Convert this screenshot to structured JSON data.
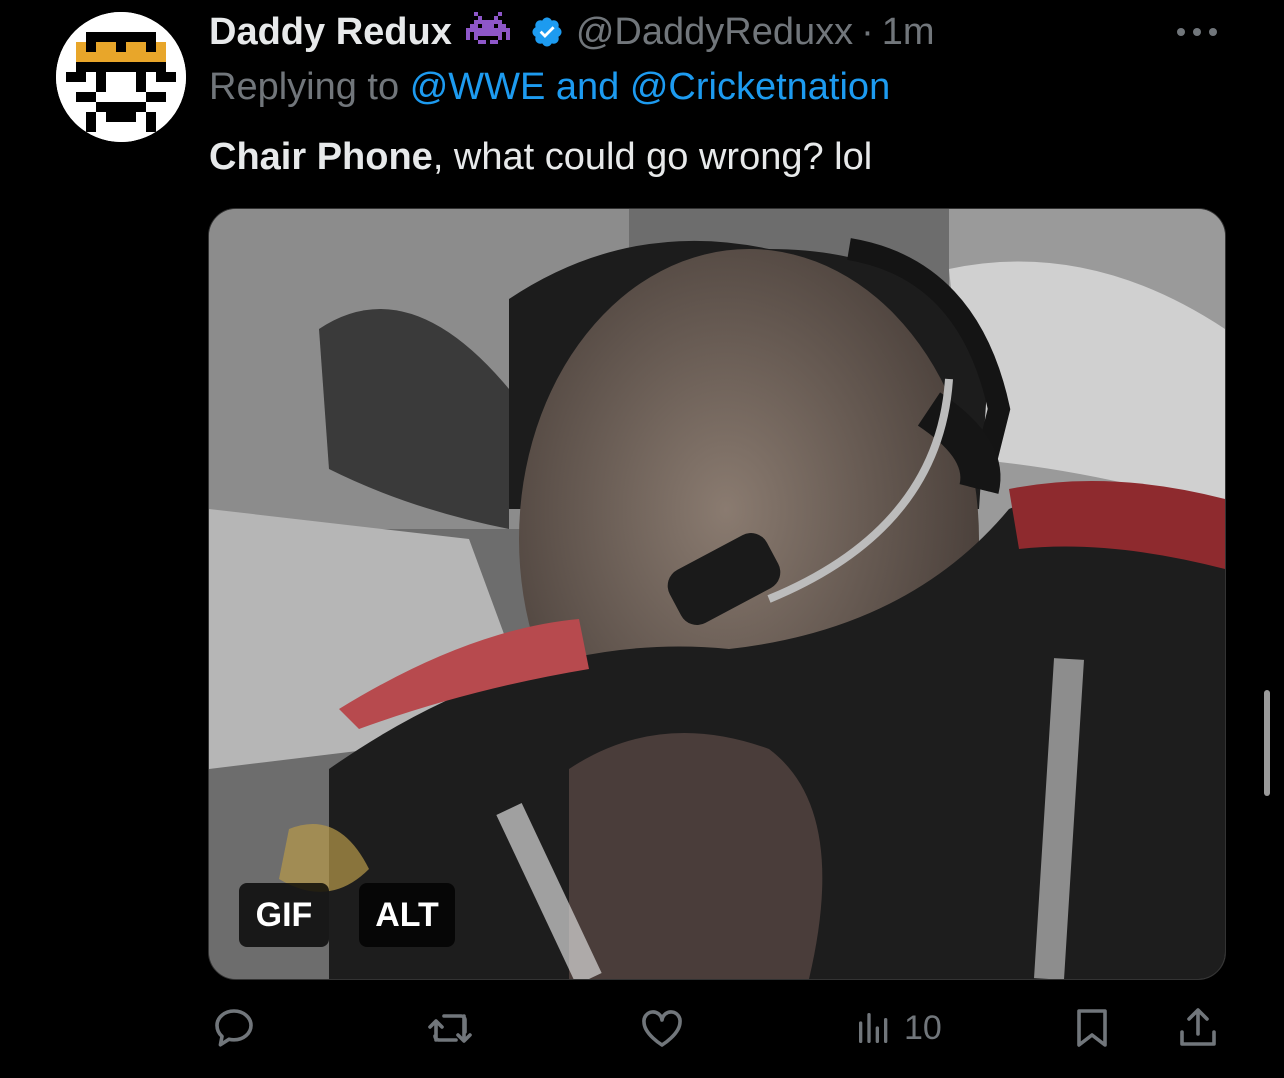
{
  "tweet": {
    "display_name": "Daddy Redux",
    "handle": "@DaddyReduxx",
    "separator": "·",
    "timestamp": "1m",
    "reply_prefix": "Replying to",
    "reply_to": "@WWE and @Cricketnation",
    "text_bold": "Chair Phone",
    "text_rest": ", what could go wrong? lol"
  },
  "media": {
    "gif_label": "GIF",
    "alt_label": "ALT"
  },
  "actions": {
    "views": "10"
  },
  "colors": {
    "background": "#000000",
    "text": "#e7e9ea",
    "muted": "#71767b",
    "link": "#1d9bf0",
    "verified": "#1d9bf0",
    "emoji_purple": "#8e57c9"
  },
  "icons": [
    "avatar-pixel-art",
    "alien-monster-emoji-icon",
    "verified-badge-icon",
    "more-options-icon",
    "reply-icon",
    "retweet-icon",
    "like-icon",
    "views-icon",
    "bookmark-icon",
    "share-icon"
  ]
}
